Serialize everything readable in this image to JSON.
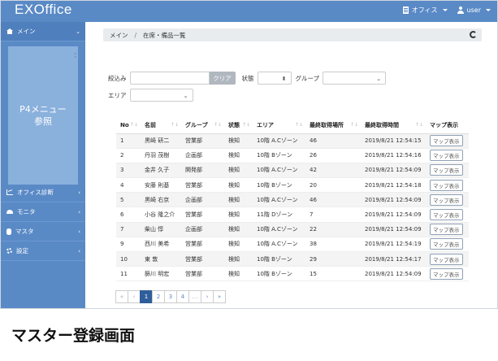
{
  "app": {
    "title": "EXOffice"
  },
  "topbar": {
    "office_label": "オフィス",
    "user_label": "user"
  },
  "sidebar": {
    "main_label": "メイン",
    "panel_text": "P4メニュー\n参照",
    "items": [
      {
        "label": "オフィス診断",
        "icon": "chart-icon"
      },
      {
        "label": "モニタ",
        "icon": "gauge-icon"
      },
      {
        "label": "マスタ",
        "icon": "database-icon"
      },
      {
        "label": "設定",
        "icon": "gear-icon"
      }
    ]
  },
  "breadcrumb": {
    "root": "メイン",
    "separator": "/",
    "current": "在席・備品一覧"
  },
  "filters": {
    "narrow_label": "絞込み",
    "clear_button": "クリア",
    "status_label": "状態",
    "group_label": "グループ",
    "area_label": "エリア"
  },
  "table": {
    "headers": [
      "No",
      "名前",
      "グループ",
      "状態",
      "エリア",
      "最終取得場所",
      "最終取得時間",
      "マップ表示"
    ],
    "map_button": "マップ表示",
    "rows": [
      [
        "1",
        "黒崎 研二",
        "営業部",
        "検知",
        "10階 A.Cゾーン",
        "46",
        "2019/8/21 12:54:15"
      ],
      [
        "2",
        "丹羽 茂樹",
        "企画部",
        "検知",
        "10階 Bゾーン",
        "26",
        "2019/8/21 12:54:16"
      ],
      [
        "3",
        "金井 久子",
        "開発部",
        "検知",
        "10階 A.Cゾーン",
        "42",
        "2019/8/21 12:54:09"
      ],
      [
        "4",
        "安藤 則基",
        "営業部",
        "検知",
        "10階 Bゾーン",
        "20",
        "2019/8/21 12:54:18"
      ],
      [
        "5",
        "黒崎 右京",
        "企画部",
        "検知",
        "10階 A.Cゾーン",
        "46",
        "2019/8/21 12:54:09"
      ],
      [
        "6",
        "小谷 隆之介",
        "営業部",
        "検知",
        "11階 Dゾーン",
        "7",
        "2019/8/21 12:54:09"
      ],
      [
        "7",
        "柴山 惇",
        "企画部",
        "検知",
        "10階 A.Cゾーン",
        "22",
        "2019/8/21 12:54:09"
      ],
      [
        "9",
        "西川 美希",
        "営業部",
        "検知",
        "10階 A.Cゾーン",
        "38",
        "2019/8/21 12:54:19"
      ],
      [
        "10",
        "東 敦",
        "営業部",
        "検知",
        "10階 Bゾーン",
        "29",
        "2019/8/21 12:54:17"
      ],
      [
        "11",
        "篩川 明宏",
        "営業部",
        "検知",
        "10階 Bゾーン",
        "15",
        "2019/8/21 12:54:09"
      ]
    ]
  },
  "pagination": {
    "first": "«",
    "prev": "‹",
    "pages": [
      "1",
      "2",
      "3",
      "4"
    ],
    "ellipsis": "…",
    "next": "›",
    "last": "»",
    "active": "1"
  },
  "caption": "マスター登録画面"
}
